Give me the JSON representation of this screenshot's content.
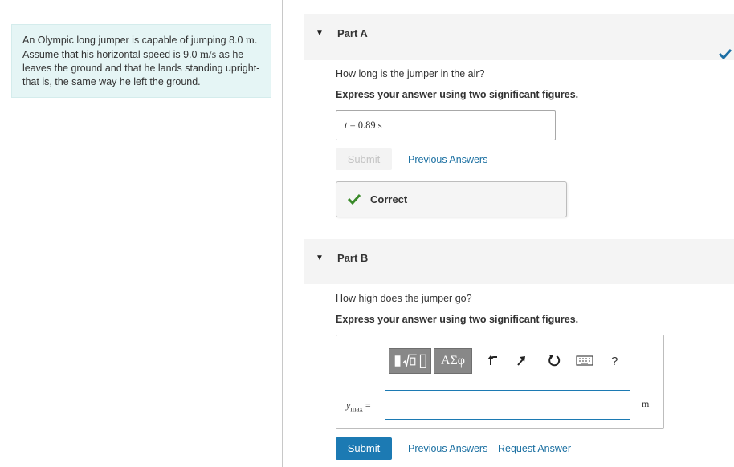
{
  "problem": {
    "text_1": "An Olympic long jumper is capable of jumping 8.0",
    "unit_m": "m",
    "text_2": ". Assume that his horizontal speed is 9.0 ",
    "unit_ms": "m/s",
    "text_3": " as he leaves the ground and that he lands standing upright-that is, the same way he left the ground."
  },
  "part_a": {
    "title": "Part A",
    "question": "How long is the jumper in the air?",
    "instruction": "Express your answer using two significant figures.",
    "answer_var": "t",
    "answer_eq": " = ",
    "answer_value": "0.89",
    "answer_unit": "s",
    "submit_label": "Submit",
    "previous_answers": "Previous Answers",
    "feedback": "Correct"
  },
  "part_b": {
    "title": "Part B",
    "question": "How high does the jumper go?",
    "instruction": "Express your answer using two significant figures.",
    "toolbar": {
      "symbols_label": "ΑΣφ",
      "help_label": "?",
      "icons": [
        "templates-icon",
        "undo-icon",
        "redo-icon",
        "reset-icon",
        "keyboard-icon",
        "help-icon"
      ]
    },
    "var_label": "y",
    "var_subscript": "max",
    "var_eq": " =",
    "input_value": "",
    "unit": "m",
    "submit_label": "Submit",
    "previous_answers": "Previous Answers",
    "request_answer": "Request Answer"
  },
  "colors": {
    "accent": "#1c7ab3",
    "correct": "#3a8a2a",
    "problem_bg": "#e5f5f5"
  }
}
